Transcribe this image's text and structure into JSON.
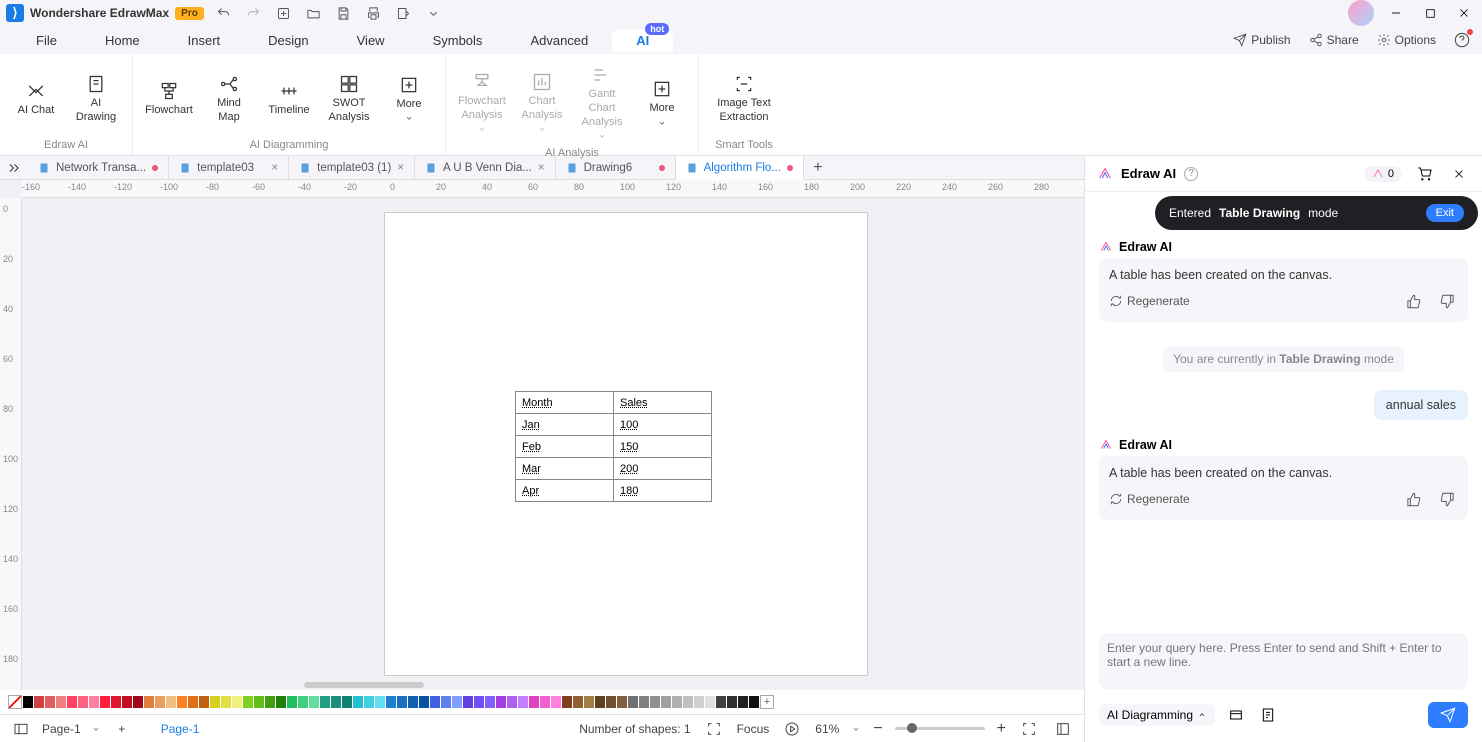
{
  "app": {
    "title": "Wondershare EdrawMax",
    "badge": "Pro"
  },
  "menus": [
    "File",
    "Home",
    "Insert",
    "Design",
    "View",
    "Symbols",
    "Advanced",
    "AI"
  ],
  "menu_hot": "hot",
  "menu_right": {
    "publish": "Publish",
    "share": "Share",
    "options": "Options"
  },
  "ribbon": {
    "edraw_ai": {
      "label": "Edraw AI",
      "tools": [
        {
          "name": "AI Chat"
        },
        {
          "name": "AI Drawing"
        }
      ]
    },
    "ai_diagramming": {
      "label": "AI Diagramming",
      "tools": [
        {
          "name": "Flowchart"
        },
        {
          "name": "Mind Map"
        },
        {
          "name": "Timeline"
        },
        {
          "name": "SWOT Analysis"
        },
        {
          "name": "More"
        }
      ]
    },
    "ai_analysis": {
      "label": "AI Analysis",
      "tools": [
        {
          "name": "Flowchart Analysis"
        },
        {
          "name": "Chart Analysis"
        },
        {
          "name": "Gantt Chart Analysis"
        },
        {
          "name": "More"
        }
      ]
    },
    "smart_tools": {
      "label": "Smart Tools",
      "tools": [
        {
          "name": "Image Text Extraction"
        }
      ]
    }
  },
  "tabs": [
    {
      "label": "Network Transa...",
      "dirty": true
    },
    {
      "label": "template03",
      "dirty": false,
      "closable": true
    },
    {
      "label": "template03 (1)",
      "dirty": false,
      "closable": true
    },
    {
      "label": "A U B Venn Dia...",
      "dirty": false,
      "closable": true
    },
    {
      "label": "Drawing6",
      "dirty": true
    },
    {
      "label": "Algorithm Flo...",
      "dirty": true,
      "active": true
    }
  ],
  "ruler_h": [
    "-160",
    "-140",
    "-120",
    "-100",
    "-80",
    "-60",
    "-40",
    "-20",
    "0",
    "20",
    "40",
    "60",
    "80",
    "100",
    "120",
    "140",
    "160",
    "180",
    "200",
    "220",
    "240",
    "260",
    "280"
  ],
  "ruler_v": [
    "0",
    "20",
    "40",
    "60",
    "80",
    "100",
    "120",
    "140",
    "160",
    "180"
  ],
  "canvas_table": {
    "headers": [
      "Month",
      "Sales"
    ],
    "rows": [
      [
        "Jan",
        "100"
      ],
      [
        "Feb",
        "150"
      ],
      [
        "Mar",
        "200"
      ],
      [
        "Apr",
        "180"
      ]
    ]
  },
  "ai": {
    "title": "Edraw AI",
    "tokens": "0",
    "toast_pre": "Entered ",
    "toast_bold": "Table Drawing",
    "toast_post": " mode",
    "toast_exit": "Exit",
    "sender": "Edraw AI",
    "msg1": "A table has been created on the canvas.",
    "regenerate": "Regenerate",
    "mode_note_pre": "You are currently in ",
    "mode_note_bold": "Table Drawing",
    "mode_note_post": " mode",
    "user_msg": "annual sales",
    "msg2": "A table has been created on the canvas.",
    "placeholder": "Enter your query here. Press Enter to send and Shift + Enter to start a new line.",
    "mode": "AI Diagramming"
  },
  "status": {
    "page_sel": "Page-1",
    "page_active": "Page-1",
    "shapes": "Number of shapes: 1",
    "focus": "Focus",
    "zoom": "61%"
  },
  "palette": [
    "#000000",
    "#d04040",
    "#e06060",
    "#f08080",
    "#ff4060",
    "#ff6080",
    "#ff80a0",
    "#ff2040",
    "#e01530",
    "#c01020",
    "#a00818",
    "#e08040",
    "#e8a060",
    "#f0c080",
    "#ff8020",
    "#e07018",
    "#c06010",
    "#d8d020",
    "#e0e040",
    "#f0f080",
    "#80d020",
    "#60c018",
    "#40a010",
    "#208008",
    "#20c060",
    "#40d080",
    "#60e0a0",
    "#20a080",
    "#18907a",
    "#108070",
    "#20c0d0",
    "#40d0e0",
    "#60e0f0",
    "#2080d0",
    "#1870c0",
    "#1060b0",
    "#0850a0",
    "#4060e0",
    "#6080f0",
    "#80a0ff",
    "#6040e0",
    "#7050f0",
    "#8060ff",
    "#a040e0",
    "#b060f0",
    "#c080ff",
    "#e040c0",
    "#f060d0",
    "#ff80e0",
    "#804020",
    "#906030",
    "#a08040",
    "#604020",
    "#705030",
    "#806040",
    "#707070",
    "#808080",
    "#909090",
    "#a0a0a0",
    "#b0b0b0",
    "#c0c0c0",
    "#d0d0d0",
    "#e0e0e0",
    "#404040",
    "#303030",
    "#202020",
    "#101010"
  ]
}
